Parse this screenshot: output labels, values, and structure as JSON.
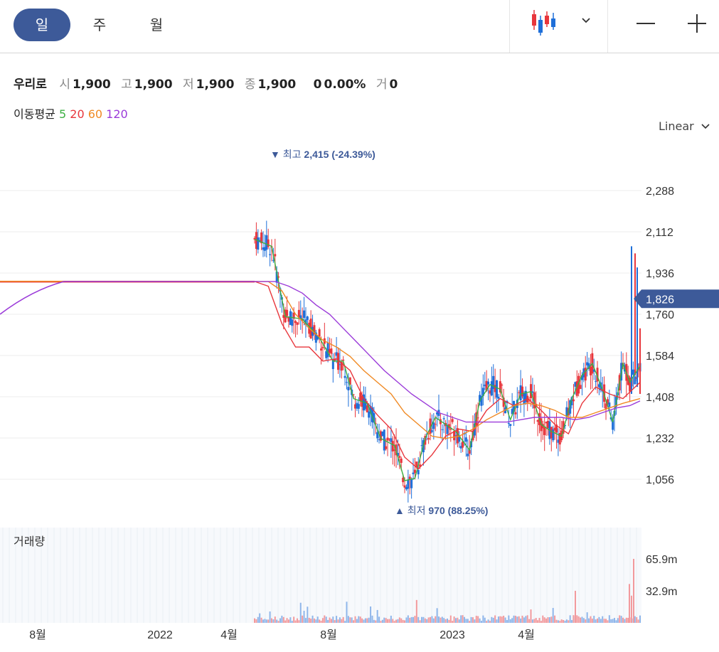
{
  "tabs": [
    {
      "label": "일",
      "active": true
    },
    {
      "label": "주",
      "active": false
    },
    {
      "label": "월",
      "active": false
    }
  ],
  "toolbar": {
    "chart_type_icon": "candlestick-icon",
    "dropdown_icon": "chevron-down-icon",
    "zoom_out_icon": "minus-icon",
    "zoom_in_icon": "plus-icon"
  },
  "stock": {
    "name": "우리로",
    "open_label": "시",
    "open": "1,900",
    "high_label": "고",
    "high": "1,900",
    "low_label": "저",
    "low": "1,900",
    "close_label": "종",
    "close": "1,900",
    "change": "0",
    "change_pct": "0.00%",
    "volume_label": "거",
    "volume": "0"
  },
  "ma": {
    "label": "이동평균",
    "periods": [
      {
        "value": "5",
        "color": "#3cb043"
      },
      {
        "value": "20",
        "color": "#e8363c"
      },
      {
        "value": "60",
        "color": "#f08a24"
      },
      {
        "value": "120",
        "color": "#9b3bd9"
      }
    ]
  },
  "scale_mode": "Linear",
  "volume_label": "거래량",
  "colors": {
    "up": "#e8363c",
    "down": "#1e6fd9",
    "accent": "#3d5a99",
    "grid": "#ececec",
    "ann": "#3d5a99"
  },
  "chart_data": {
    "type": "candlestick",
    "price_axis": {
      "ticks": [
        "2,288",
        "2,112",
        "1,936",
        "1,760",
        "1,584",
        "1,408",
        "1,232",
        "1,056"
      ],
      "tick_values": [
        2288,
        2112,
        1936,
        1760,
        1584,
        1408,
        1232,
        1056
      ],
      "range": [
        900,
        2500
      ]
    },
    "volume_axis": {
      "ticks": [
        "65.9m",
        "32.9m"
      ],
      "tick_values": [
        65.9,
        32.9
      ],
      "unit": "m"
    },
    "x_labels": [
      "8월",
      "2022",
      "4월",
      "8월",
      "2023",
      "4월"
    ],
    "current_price": {
      "label": "1,826",
      "value": 1826
    },
    "high_annotation": {
      "marker": "▼",
      "label": "최고",
      "value_text": "2,415 (-24.39%)",
      "value": 2415
    },
    "low_annotation": {
      "marker": "▲",
      "label": "최저",
      "value_text": "970 (88.25%)",
      "value": 970
    },
    "flat_price": 1900,
    "flat_ma120_start": 1760,
    "series": [
      {
        "name": "5",
        "color": "#3cb043",
        "points": [
          [
            0,
            2080
          ],
          [
            5,
            2050
          ],
          [
            9,
            1750
          ],
          [
            14,
            1740
          ],
          [
            19,
            1660
          ],
          [
            23,
            1560
          ],
          [
            26,
            1560
          ],
          [
            29,
            1400
          ],
          [
            33,
            1380
          ],
          [
            37,
            1230
          ],
          [
            41,
            1200
          ],
          [
            44,
            1050
          ],
          [
            47,
            1060
          ],
          [
            50,
            1230
          ],
          [
            53,
            1320
          ],
          [
            56,
            1290
          ],
          [
            59,
            1260
          ],
          [
            63,
            1180
          ],
          [
            66,
            1390
          ],
          [
            69,
            1460
          ],
          [
            72,
            1440
          ],
          [
            75,
            1310
          ],
          [
            78,
            1420
          ],
          [
            81,
            1430
          ],
          [
            84,
            1290
          ],
          [
            87,
            1260
          ],
          [
            90,
            1240
          ],
          [
            93,
            1400
          ],
          [
            96,
            1500
          ],
          [
            99,
            1550
          ],
          [
            102,
            1440
          ],
          [
            105,
            1300
          ],
          [
            108,
            1550
          ],
          [
            110,
            1470
          ],
          [
            113,
            1540
          ]
        ]
      },
      {
        "name": "20",
        "color": "#e8363c",
        "points": [
          [
            0,
            1900
          ],
          [
            4,
            1880
          ],
          [
            8,
            1720
          ],
          [
            12,
            1620
          ],
          [
            16,
            1620
          ],
          [
            20,
            1560
          ],
          [
            24,
            1570
          ],
          [
            28,
            1520
          ],
          [
            32,
            1400
          ],
          [
            36,
            1330
          ],
          [
            40,
            1270
          ],
          [
            44,
            1150
          ],
          [
            48,
            1100
          ],
          [
            52,
            1160
          ],
          [
            56,
            1240
          ],
          [
            60,
            1270
          ],
          [
            64,
            1260
          ],
          [
            68,
            1350
          ],
          [
            72,
            1400
          ],
          [
            76,
            1370
          ],
          [
            80,
            1400
          ],
          [
            84,
            1350
          ],
          [
            88,
            1290
          ],
          [
            92,
            1250
          ],
          [
            96,
            1380
          ],
          [
            100,
            1450
          ],
          [
            104,
            1420
          ],
          [
            108,
            1400
          ],
          [
            113,
            1470
          ]
        ]
      },
      {
        "name": "60",
        "color": "#f08a24",
        "points": [
          [
            0,
            1900
          ],
          [
            4,
            1900
          ],
          [
            8,
            1860
          ],
          [
            12,
            1760
          ],
          [
            16,
            1700
          ],
          [
            20,
            1650
          ],
          [
            24,
            1620
          ],
          [
            28,
            1580
          ],
          [
            32,
            1520
          ],
          [
            36,
            1470
          ],
          [
            40,
            1420
          ],
          [
            44,
            1340
          ],
          [
            48,
            1290
          ],
          [
            52,
            1240
          ],
          [
            56,
            1230
          ],
          [
            60,
            1240
          ],
          [
            64,
            1270
          ],
          [
            68,
            1310
          ],
          [
            72,
            1340
          ],
          [
            76,
            1370
          ],
          [
            80,
            1380
          ],
          [
            84,
            1370
          ],
          [
            88,
            1350
          ],
          [
            92,
            1320
          ],
          [
            96,
            1320
          ],
          [
            100,
            1340
          ],
          [
            104,
            1360
          ],
          [
            108,
            1380
          ],
          [
            113,
            1400
          ]
        ]
      },
      {
        "name": "120",
        "color": "#9b3bd9",
        "points": [
          [
            0,
            1900
          ],
          [
            6,
            1900
          ],
          [
            10,
            1880
          ],
          [
            14,
            1850
          ],
          [
            18,
            1800
          ],
          [
            22,
            1760
          ],
          [
            26,
            1700
          ],
          [
            30,
            1640
          ],
          [
            34,
            1580
          ],
          [
            38,
            1520
          ],
          [
            42,
            1470
          ],
          [
            46,
            1420
          ],
          [
            50,
            1380
          ],
          [
            54,
            1340
          ],
          [
            58,
            1320
          ],
          [
            62,
            1300
          ],
          [
            66,
            1300
          ],
          [
            70,
            1300
          ],
          [
            74,
            1300
          ],
          [
            78,
            1310
          ],
          [
            82,
            1320
          ],
          [
            86,
            1320
          ],
          [
            90,
            1320
          ],
          [
            94,
            1310
          ],
          [
            98,
            1320
          ],
          [
            102,
            1340
          ],
          [
            106,
            1360
          ],
          [
            110,
            1370
          ],
          [
            113,
            1390
          ]
        ]
      }
    ]
  }
}
